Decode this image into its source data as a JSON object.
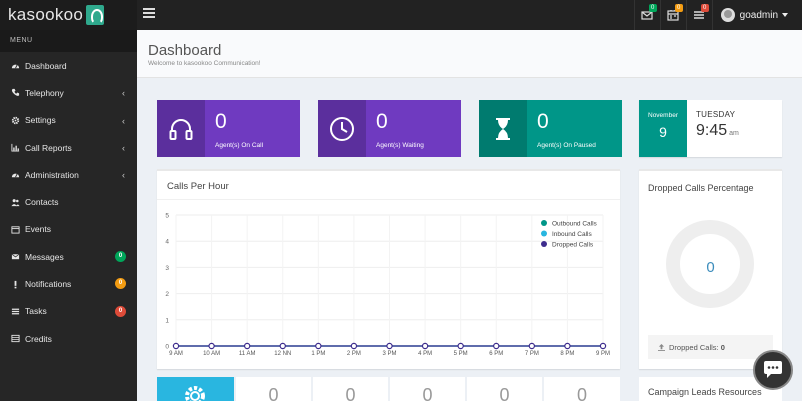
{
  "brand": {
    "name": "kasookoo"
  },
  "topbar": {
    "icons": [
      {
        "icon": "envelope-icon",
        "badge": "0",
        "badge_color": "#00a65a"
      },
      {
        "icon": "calendar-icon",
        "badge": "0",
        "badge_color": "#f39c12"
      },
      {
        "icon": "tasks-icon",
        "badge": "0",
        "badge_color": "#dd4b39"
      }
    ],
    "user": "goadmin"
  },
  "sidebar": {
    "header": "MENU",
    "items": [
      {
        "label": "Dashboard",
        "icon": "dashboard-icon",
        "chevron": false
      },
      {
        "label": "Telephony",
        "icon": "phone-icon",
        "chevron": true
      },
      {
        "label": "Settings",
        "icon": "gear-icon",
        "chevron": true
      },
      {
        "label": "Call Reports",
        "icon": "bar-chart-icon",
        "chevron": true
      },
      {
        "label": "Administration",
        "icon": "dashboard-icon",
        "chevron": true
      },
      {
        "label": "Contacts",
        "icon": "users-icon",
        "chevron": false
      },
      {
        "label": "Events",
        "icon": "calendar-icon",
        "chevron": false
      },
      {
        "label": "Messages",
        "icon": "envelope-icon",
        "badge": "0",
        "badge_color": "#00a65a"
      },
      {
        "label": "Notifications",
        "icon": "exclamation-icon",
        "badge": "0",
        "badge_color": "#f39c12"
      },
      {
        "label": "Tasks",
        "icon": "tasks-icon",
        "badge": "0",
        "badge_color": "#dd4b39"
      },
      {
        "label": "Credits",
        "icon": "list-icon",
        "chevron": false
      }
    ]
  },
  "header": {
    "title": "Dashboard",
    "subtitle": "Welcome to kasookoo Communication!"
  },
  "stats": [
    {
      "value": "0",
      "label": "Agent(s) On Call",
      "icon": "headphones-icon",
      "color": "#6f3ac0"
    },
    {
      "value": "0",
      "label": "Agent(s) Waiting",
      "icon": "clock-icon",
      "color": "#6f3ac0"
    },
    {
      "value": "0",
      "label": "Agent(s) On Paused",
      "icon": "hourglass-icon",
      "color": "#009688"
    }
  ],
  "date": {
    "month": "November",
    "day": "9",
    "weekday": "TUESDAY",
    "time": "9:45",
    "ampm": "am"
  },
  "calls_chart": {
    "title": "Calls Per Hour"
  },
  "chart_data": {
    "type": "line",
    "categories": [
      "9 AM",
      "10 AM",
      "11 AM",
      "12 NN",
      "1 PM",
      "2 PM",
      "3 PM",
      "4 PM",
      "5 PM",
      "6 PM",
      "7 PM",
      "8 PM",
      "9 PM"
    ],
    "series": [
      {
        "name": "Outbound Calls",
        "color": "#009688",
        "values": [
          0,
          0,
          0,
          0,
          0,
          0,
          0,
          0,
          0,
          0,
          0,
          0,
          0
        ]
      },
      {
        "name": "Inbound Calls",
        "color": "#29b6e0",
        "values": [
          0,
          0,
          0,
          0,
          0,
          0,
          0,
          0,
          0,
          0,
          0,
          0,
          0
        ]
      },
      {
        "name": "Dropped Calls",
        "color": "#3d2c8d",
        "values": [
          0,
          0,
          0,
          0,
          0,
          0,
          0,
          0,
          0,
          0,
          0,
          0,
          0
        ]
      }
    ],
    "ylim": [
      0,
      5
    ],
    "yticks": [
      "0",
      "1",
      "2",
      "3",
      "4",
      "5"
    ],
    "grid": true,
    "legend": "top-right"
  },
  "dropped": {
    "title": "Dropped Calls Percentage",
    "value": "0",
    "footer_label": "Dropped Calls:",
    "footer_value": "0"
  },
  "bottom_stats": {
    "values": [
      "0",
      "0",
      "0",
      "0",
      "0"
    ]
  },
  "campaign": {
    "title": "Campaign Leads Resources"
  }
}
